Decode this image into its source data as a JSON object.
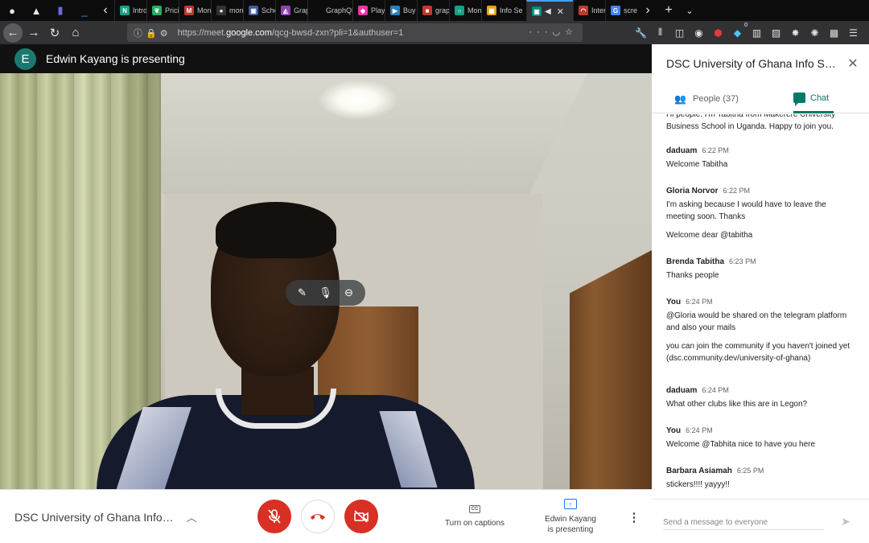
{
  "browser": {
    "tabs": [
      {
        "label": "Introd",
        "icon": "notion-icon",
        "color": "#16a085",
        "glyph": "N"
      },
      {
        "label": "Pricin",
        "icon": "leaf-icon",
        "color": "#27ae60",
        "glyph": "❦"
      },
      {
        "label": "Mong",
        "icon": "bookmark-icon",
        "color": "#c0392b",
        "glyph": "M"
      },
      {
        "label": "mong",
        "icon": "github-icon",
        "color": "#333333",
        "glyph": "●"
      },
      {
        "label": "Schoo",
        "icon": "window-icon",
        "color": "#3d5a99",
        "glyph": "▣"
      },
      {
        "label": "Graph",
        "icon": "triangle-icon",
        "color": "#8e44ad",
        "glyph": "◭"
      },
      {
        "label": "GraphQL p",
        "icon": "blank-icon",
        "color": "#0c0c0d",
        "glyph": ""
      },
      {
        "label": "Playgr",
        "icon": "graphql-icon",
        "color": "#e535ab",
        "glyph": "◆"
      },
      {
        "label": "Buy it",
        "icon": "video-icon",
        "color": "#2980b9",
        "glyph": "▶"
      },
      {
        "label": "graph",
        "icon": "bookmark-icon",
        "color": "#c0392b",
        "glyph": "■"
      },
      {
        "label": "Mome",
        "icon": "clock-icon",
        "color": "#16a085",
        "glyph": "○"
      },
      {
        "label": "Info Se",
        "icon": "calendar-icon",
        "color": "#f39c12",
        "glyph": "▦"
      }
    ],
    "active_tab": {
      "icon": "meet-icon",
      "glyph": "▣",
      "color": "#00897b"
    },
    "tabs_after": [
      {
        "label": "Intern",
        "icon": "gauge-icon",
        "color": "#c0392b",
        "glyph": "◠"
      },
      {
        "label": "screen",
        "icon": "google-icon",
        "color": "#4285f4",
        "glyph": "G"
      }
    ],
    "url": {
      "prefix": "https://meet.",
      "domain": "google.com",
      "path": "/qcg-bwsd-zxn?pli=1&authuser=1"
    },
    "notification_count": "0"
  },
  "meeting": {
    "presenter_initial": "E",
    "presenter_text": "Edwin Kayang is presenting",
    "title": "DSC University of Ghana Info Se...",
    "captions_label": "Turn on captions",
    "cc_label": "CC",
    "presenting_label_1": "Edwin Kayang",
    "presenting_label_2": "is presenting"
  },
  "panel": {
    "title": "DSC University of Ghana Info Ses...",
    "people_label": "People (37)",
    "chat_label": "Chat",
    "cut_message": "Hi people. I'm Tabitha from Makerere University Business School in Uganda. Happy to join you.",
    "messages": [
      {
        "sender": "daduam",
        "time": "6:22 PM",
        "texts": [
          "Welcome Tabitha"
        ]
      },
      {
        "sender": "Gloria Norvor",
        "time": "6:22 PM",
        "texts": [
          "I'm asking because I would have to leave the meeting soon. Thanks",
          "Welcome dear @tabitha"
        ]
      },
      {
        "sender": "Brenda Tabitha",
        "time": "6:23 PM",
        "texts": [
          "Thanks people"
        ]
      },
      {
        "sender": "You",
        "time": "6:24 PM",
        "texts": [
          "@Gloria would be shared on the telegram platform and also your mails",
          "you can join the community if you haven't joined yet (dsc.community.dev/university-of-ghana)"
        ]
      },
      {
        "sender": "daduam",
        "time": "6:24 PM",
        "texts": [
          "What other clubs like this are in Legon?"
        ]
      },
      {
        "sender": "You",
        "time": "6:24 PM",
        "texts": [
          "Welcome @Tabhita nice to have you here"
        ]
      },
      {
        "sender": "Barbara Asiamah",
        "time": "6:25 PM",
        "texts": [
          "stickers!!!! yayyy!!"
        ]
      }
    ],
    "compose_placeholder": "Send a message to everyone"
  },
  "colors": {
    "accent_teal": "#00796b",
    "end_call_red": "#d93025",
    "present_blue": "#1a73e8"
  }
}
